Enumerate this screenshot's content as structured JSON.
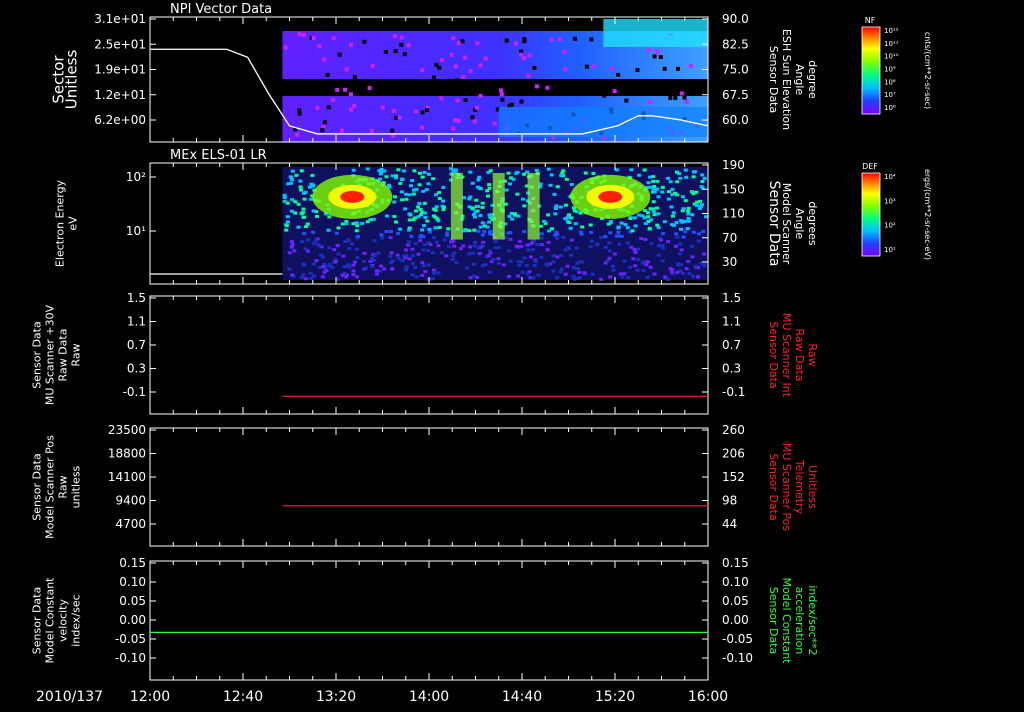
{
  "date_label": "2010/137",
  "time_ticks": [
    "12:00",
    "12:40",
    "13:20",
    "14:00",
    "14:40",
    "15:20",
    "16:00"
  ],
  "chart_data": [
    {
      "type": "heatmap",
      "title": "NPI Vector Data",
      "ylabel_left": [
        "Sector",
        "Unitless"
      ],
      "yticks_left": [
        "3.1e+01",
        "2.5e+01",
        "1.9e+01",
        "1.2e+01",
        "6.2e+00"
      ],
      "ylabel_right": [
        "Sensor Data",
        "ESH Sun Elevation",
        "Angle",
        "degree"
      ],
      "yticks_right": [
        "90.0",
        "82.5",
        "75.0",
        "67.5",
        "60.0"
      ],
      "colorbar_label": "NF",
      "colorbar_units": "cnts/(cm**2-sr-sec)",
      "colorbar_ticks": [
        "10¹²",
        "10¹¹",
        "10¹⁰",
        "10⁹",
        "10⁸",
        "10⁷",
        "10⁶"
      ],
      "line": {
        "color": "#ffffff",
        "t_hours": [
          12.0,
          12.55,
          12.7,
          12.85,
          13.0,
          13.2,
          14.5,
          15.1,
          15.35,
          15.5,
          15.6,
          15.8,
          16.0
        ],
        "values": [
          23,
          23,
          21,
          12,
          4,
          2,
          2,
          2,
          4,
          6.5,
          6.5,
          5.5,
          4
        ]
      }
    },
    {
      "type": "heatmap",
      "title": "MEx ELS-01 LR",
      "ylabel_left": [
        "Electron Energy",
        "eV"
      ],
      "yticks_left": [
        "10²",
        "10¹"
      ],
      "ylabel_right": [
        "Sensor Data",
        "Model Scanner",
        "Angle",
        "degrees"
      ],
      "yticks_right": [
        "190",
        "150",
        "110",
        "70",
        "30"
      ],
      "colorbar_label": "DEF",
      "colorbar_units": "ergs/(cm**2-sr-sec-eV)",
      "colorbar_ticks": [
        "10⁴",
        "10³",
        "10²",
        "10¹"
      ],
      "line": {
        "color": "#ffffff",
        "value": 2
      }
    },
    {
      "type": "line",
      "ylabel_left": [
        "Sensor Data",
        "MU Scanner +30V",
        "Raw Data",
        "Raw"
      ],
      "yticks_left": [
        "1.5",
        "1.1",
        "0.7",
        "0.3",
        "-0.1"
      ],
      "ylabel_right": [
        "Sensor Data",
        "MU Scanner Int",
        "Raw Data",
        "Raw"
      ],
      "yticks_right": [
        "1.5",
        "1.1",
        "0.7",
        "0.3",
        "-0.1"
      ],
      "ylim": [
        -0.3,
        1.5
      ],
      "series": [
        {
          "color": "#ff2020",
          "t_start": 12.95,
          "t_end": 16.0,
          "value": -0.03
        }
      ]
    },
    {
      "type": "line",
      "ylabel_left": [
        "Sensor Data",
        "Model Scanner Pos",
        "Raw",
        "unitless"
      ],
      "yticks_left": [
        "23500",
        "18800",
        "14100",
        "9400",
        "4700"
      ],
      "ylabel_right": [
        "Sensor Data",
        "MU Scanner Pos",
        "Telemetry",
        "Unitless"
      ],
      "yticks_right": [
        "260",
        "206",
        "152",
        "98",
        "44"
      ],
      "ylim": [
        0,
        23500
      ],
      "series": [
        {
          "color": "#ff2020",
          "t_start": 12.95,
          "t_end": 16.0,
          "value": 8000
        }
      ]
    },
    {
      "type": "line",
      "ylabel_left": [
        "Sensor Data",
        "Model Constant",
        "velocity",
        "index/sec"
      ],
      "yticks_left": [
        "0.15",
        "0.10",
        "0.05",
        "0.00",
        "-0.05",
        "-0.10"
      ],
      "ylabel_right": [
        "Sensor Data",
        "Model Constant",
        "acceleration",
        "index/sec**2"
      ],
      "yticks_right": [
        "0.15",
        "0.10",
        "0.05",
        "0.00",
        "-0.05",
        "-0.10"
      ],
      "ylim": [
        -0.1,
        0.15
      ],
      "series": [
        {
          "color": "#30ff30",
          "t_start": 12.0,
          "t_end": 16.0,
          "value": 0.0
        }
      ]
    }
  ]
}
